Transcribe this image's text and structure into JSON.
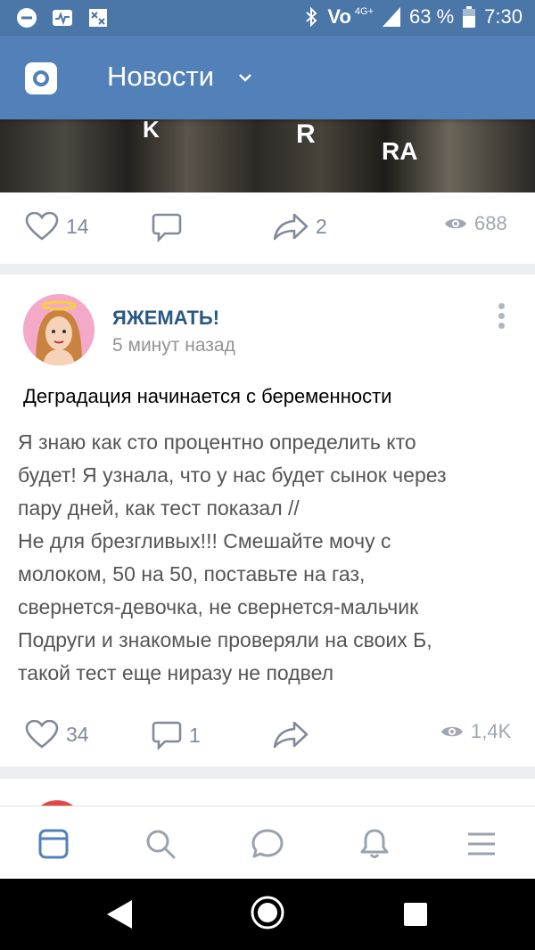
{
  "status_bar": {
    "battery_percent": "63 %",
    "time": "7:30",
    "carrier": "Vo",
    "network": "4G+"
  },
  "header": {
    "title": "Новости"
  },
  "post1": {
    "image_texts": [
      "K",
      "R",
      "RA"
    ],
    "likes": "14",
    "reposts": "2",
    "views": "688"
  },
  "post2": {
    "group_name": "ЯЖЕМАТЬ!",
    "time": "5 минут назад",
    "title": "Деградация начинается с беременности",
    "body_lines": [
      "Я знаю как сто процентно определить кто",
      "будет! Я узнала, что у нас будет сынок через",
      "пару дней, как тест показал //",
      "Не для брезгливых!!! Смешайте мочу с",
      "молоком, 50 на 50, поставьте на газ,",
      "свернется-девочка, не свернется-мальчик",
      "Подруги и знакомые проверяли на своих Б,",
      "такой тест еще ниразу не подвел"
    ],
    "likes": "34",
    "comments": "1",
    "views": "1,4K"
  },
  "bottom_nav": {
    "items": [
      "newsfeed-icon",
      "search-icon",
      "messages-icon",
      "notifications-icon",
      "menu-icon"
    ],
    "active_color": "#5181b8",
    "inactive_color": "#99a2ad"
  }
}
